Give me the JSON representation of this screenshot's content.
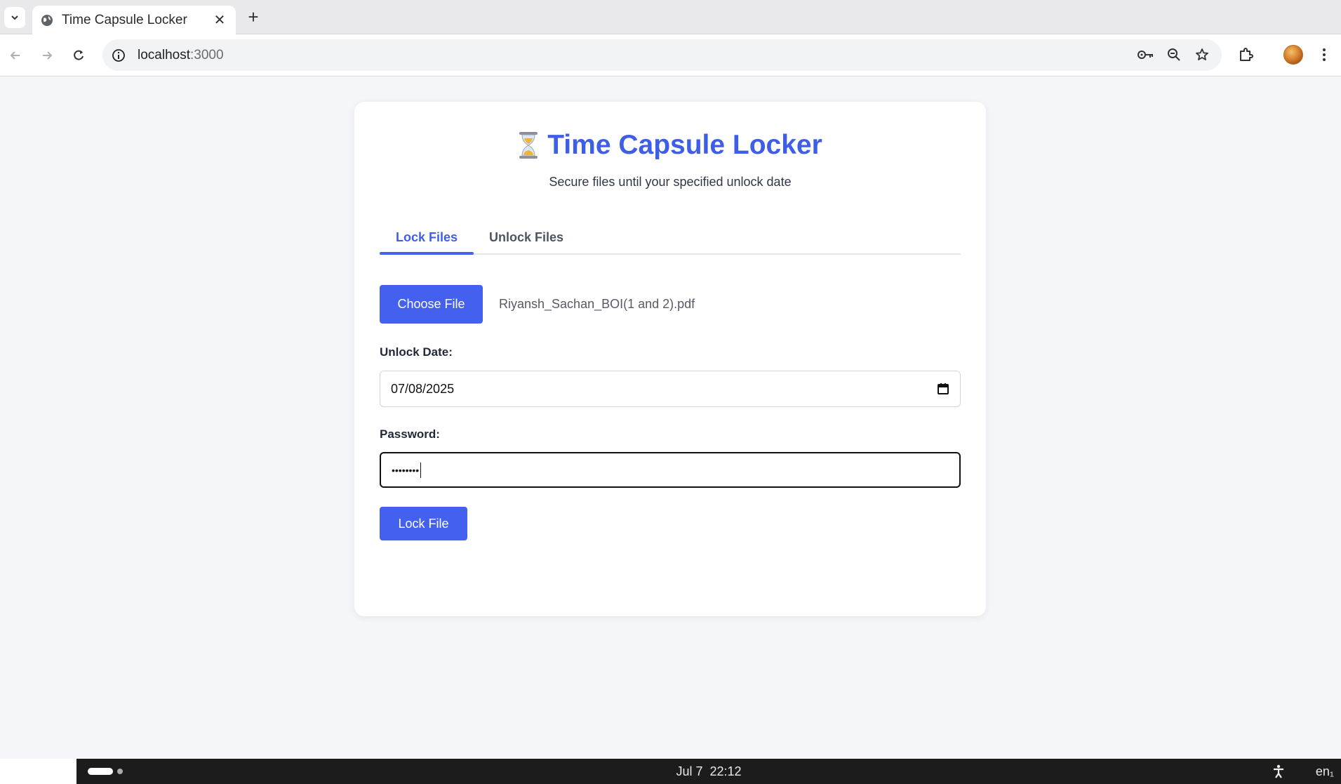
{
  "browser": {
    "tab_title": "Time Capsule Locker",
    "new_tab_symbol": "+",
    "close_symbol": "✕",
    "url_host": "localhost",
    "url_port": ":3000"
  },
  "page": {
    "title": "Time Capsule Locker",
    "title_icon": "hourglass-icon",
    "subtitle": "Secure files until your specified unlock date",
    "tabs": [
      {
        "label": "Lock Files",
        "active": true
      },
      {
        "label": "Unlock Files",
        "active": false
      }
    ],
    "file": {
      "button_label": "Choose File",
      "selected_name": "Riyansh_Sachan_BOI(1 and 2).pdf"
    },
    "unlock_date": {
      "label": "Unlock Date:",
      "value": "07/08/2025"
    },
    "password": {
      "label": "Password:",
      "masked_value": "••••••••"
    },
    "submit_label": "Lock File"
  },
  "taskbar": {
    "date": "Jul 7",
    "time": "22:12",
    "language": "en₁"
  },
  "colors": {
    "accent": "#4361ee",
    "title": "#3f5ee8",
    "background": "#f5f6fa"
  }
}
